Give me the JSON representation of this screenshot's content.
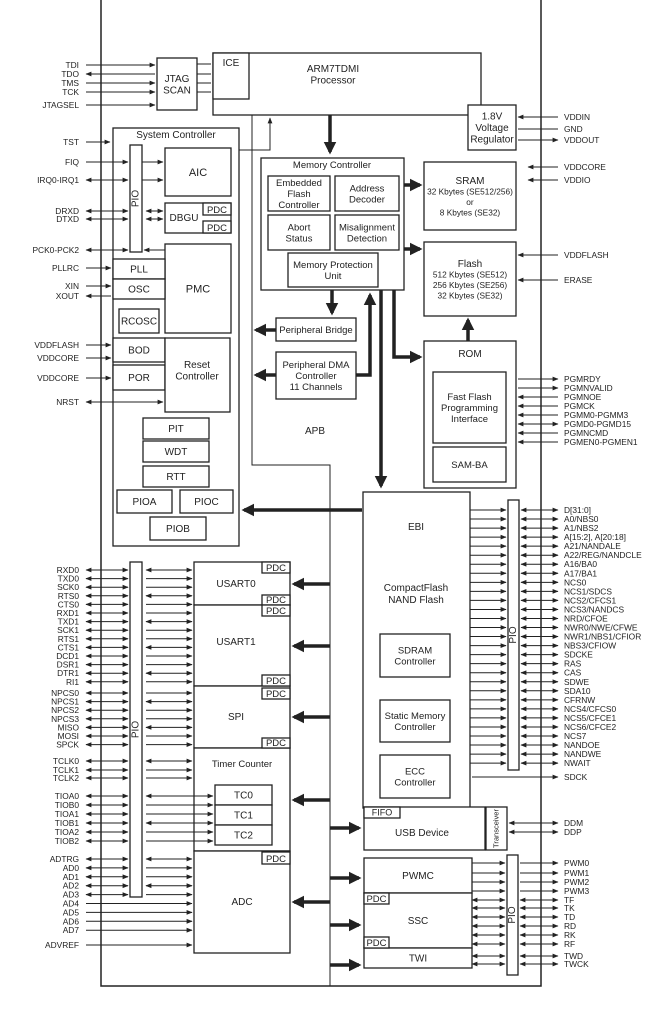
{
  "blocks": {
    "jtag": [
      "JTAG",
      "SCAN"
    ],
    "ice": [
      "ICE"
    ],
    "arm": [
      "ARM7TDMI",
      "Processor"
    ],
    "vreg": [
      "1.8V",
      "Voltage",
      "Regulator"
    ],
    "sysctrl": [
      "System Controller"
    ],
    "pio": "PIO",
    "pdc": "PDC",
    "aic": [
      "AIC"
    ],
    "dbgu": [
      "DBGU"
    ],
    "pmc": [
      "PMC"
    ],
    "pll": [
      "PLL"
    ],
    "osc": [
      "OSC"
    ],
    "rcosc": [
      "RCOSC"
    ],
    "bod": [
      "BOD"
    ],
    "por": [
      "POR"
    ],
    "reset": [
      "Reset",
      "Controller"
    ],
    "pit": [
      "PIT"
    ],
    "wdt": [
      "WDT"
    ],
    "rtt": [
      "RTT"
    ],
    "pioa": [
      "PIOA"
    ],
    "pioc": [
      "PIOC"
    ],
    "piob": [
      "PIOB"
    ],
    "memctrl": [
      "Memory Controller"
    ],
    "eflash": [
      "Embedded",
      "Flash",
      "Controller"
    ],
    "addrdec": [
      "Address",
      "Decoder"
    ],
    "abort": [
      "Abort",
      "Status"
    ],
    "misalign": [
      "Misalignment",
      "Detection"
    ],
    "mpu": [
      "Memory Protection",
      "Unit"
    ],
    "sram": [
      "SRAM",
      "32 Kbytes (SE512/256)",
      "or",
      "8 Kbytes  (SE32)"
    ],
    "flash": [
      "Flash",
      "512 Kbytes (SE512)",
      "256 Kbytes (SE256)",
      "32 Kbytes  (SE32)"
    ],
    "rom": [
      "ROM"
    ],
    "ffpi": [
      "Fast Flash",
      "Programming",
      "Interface"
    ],
    "samba": [
      "SAM-BA"
    ],
    "pbridge": [
      "Peripheral Bridge"
    ],
    "pdma": [
      "Peripheral DMA",
      "Controller",
      "11 Channels"
    ],
    "apb": "APB",
    "ebi": [
      "EBI"
    ],
    "cf": [
      "CompactFlash",
      "NAND Flash"
    ],
    "sdram": [
      "SDRAM",
      "Controller"
    ],
    "smc": [
      "Static Memory",
      "Controller"
    ],
    "ecc": [
      "ECC",
      "Controller"
    ],
    "usb": [
      "USB Device"
    ],
    "fifo": [
      "FIFO"
    ],
    "transceiver": "Transceiver",
    "pwmc": [
      "PWMC"
    ],
    "ssc": [
      "SSC"
    ],
    "twi": [
      "TWI"
    ],
    "usart0": [
      "USART0"
    ],
    "usart1": [
      "USART1"
    ],
    "spi": [
      "SPI"
    ],
    "tc": [
      "Timer Counter"
    ],
    "tc0": [
      "TC0"
    ],
    "tc1": [
      "TC1"
    ],
    "tc2": [
      "TC2"
    ],
    "adc": [
      "ADC"
    ]
  },
  "signals": {
    "left_jtag": [
      {
        "name": "TDI",
        "dir": "in"
      },
      {
        "name": "TDO",
        "dir": "out"
      },
      {
        "name": "TMS",
        "dir": "in"
      },
      {
        "name": "TCK",
        "dir": "in"
      },
      {
        "name": "JTAGSEL",
        "dir": "in"
      }
    ],
    "left_sys": [
      {
        "name": "TST",
        "dir": "in"
      },
      {
        "name": "FIQ",
        "dir": "in"
      },
      {
        "name": "IRQ0-IRQ1",
        "dir": "bi"
      },
      {
        "name": "DRXD",
        "dir": "bi"
      },
      {
        "name": "DTXD",
        "dir": "bi"
      },
      {
        "name": "PCK0-PCK2",
        "dir": "bi"
      },
      {
        "name": "PLLRC",
        "dir": "in"
      },
      {
        "name": "XIN",
        "dir": "in"
      },
      {
        "name": "XOUT",
        "dir": "out"
      },
      {
        "name": "VDDFLASH",
        "dir": "in"
      },
      {
        "name": "VDDCORE",
        "dir": "in"
      },
      {
        "name": "VDDCORE",
        "dir": "in"
      },
      {
        "name": "NRST",
        "dir": "bi"
      }
    ],
    "left_periph": [
      {
        "name": "RXD0",
        "dir": "bi"
      },
      {
        "name": "TXD0",
        "dir": "bi"
      },
      {
        "name": "SCK0",
        "dir": "bi"
      },
      {
        "name": "RTS0",
        "dir": "bi"
      },
      {
        "name": "CTS0",
        "dir": "bi"
      },
      {
        "name": "RXD1",
        "dir": "bi"
      },
      {
        "name": "TXD1",
        "dir": "bi"
      },
      {
        "name": "SCK1",
        "dir": "bi"
      },
      {
        "name": "RTS1",
        "dir": "bi"
      },
      {
        "name": "CTS1",
        "dir": "bi"
      },
      {
        "name": "DCD1",
        "dir": "bi"
      },
      {
        "name": "DSR1",
        "dir": "bi"
      },
      {
        "name": "DTR1",
        "dir": "bi"
      },
      {
        "name": "RI1",
        "dir": "bi"
      },
      {
        "name": "NPCS0",
        "dir": "bi"
      },
      {
        "name": "NPCS1",
        "dir": "bi"
      },
      {
        "name": "NPCS2",
        "dir": "bi"
      },
      {
        "name": "NPCS3",
        "dir": "bi"
      },
      {
        "name": "MISO",
        "dir": "bi"
      },
      {
        "name": "MOSI",
        "dir": "bi"
      },
      {
        "name": "SPCK",
        "dir": "bi"
      },
      {
        "name": "TCLK0",
        "dir": "bi"
      },
      {
        "name": "TCLK1",
        "dir": "bi"
      },
      {
        "name": "TCLK2",
        "dir": "bi"
      },
      {
        "name": "TIOA0",
        "dir": "bi"
      },
      {
        "name": "TIOB0",
        "dir": "bi"
      },
      {
        "name": "TIOA1",
        "dir": "bi"
      },
      {
        "name": "TIOB1",
        "dir": "bi"
      },
      {
        "name": "TIOA2",
        "dir": "bi"
      },
      {
        "name": "TIOB2",
        "dir": "bi"
      },
      {
        "name": "ADTRG",
        "dir": "bi"
      },
      {
        "name": "AD0",
        "dir": "bi"
      },
      {
        "name": "AD1",
        "dir": "bi"
      },
      {
        "name": "AD2",
        "dir": "bi"
      },
      {
        "name": "AD3",
        "dir": "bi"
      },
      {
        "name": "AD4",
        "dir": "in"
      },
      {
        "name": "AD5",
        "dir": "in"
      },
      {
        "name": "AD6",
        "dir": "in"
      },
      {
        "name": "AD7",
        "dir": "in"
      },
      {
        "name": "ADVREF",
        "dir": "in"
      }
    ],
    "right_power": [
      {
        "name": "VDDIN",
        "dir": "in"
      },
      {
        "name": "GND",
        "dir": "none"
      },
      {
        "name": "VDDOUT",
        "dir": "out"
      },
      {
        "name": "VDDCORE",
        "dir": "in"
      },
      {
        "name": "VDDIO",
        "dir": "in"
      },
      {
        "name": "VDDFLASH",
        "dir": "in"
      },
      {
        "name": "ERASE",
        "dir": "in"
      }
    ],
    "right_pgm": [
      {
        "name": "PGMRDY",
        "dir": "out"
      },
      {
        "name": "PGMNVALID",
        "dir": "out"
      },
      {
        "name": "PGMNOE",
        "dir": "in"
      },
      {
        "name": "PGMCK",
        "dir": "in"
      },
      {
        "name": "PGMM0-PGMM3",
        "dir": "in"
      },
      {
        "name": "PGMD0-PGMD15",
        "dir": "bi"
      },
      {
        "name": "PGMNCMD",
        "dir": "in"
      },
      {
        "name": "PGMEN0-PGMEN1",
        "dir": "in"
      }
    ],
    "right_ebi": [
      {
        "name": "D[31:0]",
        "dir": "bi"
      },
      {
        "name": "A0/NBS0",
        "dir": "bi"
      },
      {
        "name": "A1/NBS2",
        "dir": "bi"
      },
      {
        "name": "A[15:2], A[20:18]",
        "dir": "bi"
      },
      {
        "name": "A21/NANDALE",
        "dir": "bi"
      },
      {
        "name": "A22/REG/NANDCLE",
        "dir": "bi"
      },
      {
        "name": "A16/BA0",
        "dir": "bi"
      },
      {
        "name": "A17/BA1",
        "dir": "bi"
      },
      {
        "name": "NCS0",
        "dir": "bi"
      },
      {
        "name": "NCS1/SDCS",
        "dir": "bi"
      },
      {
        "name": "NCS2/CFCS1",
        "dir": "bi"
      },
      {
        "name": "NCS3/NANDCS",
        "dir": "bi"
      },
      {
        "name": "NRD/CFOE",
        "dir": "bi"
      },
      {
        "name": "NWR0/NWE/CFWE",
        "dir": "bi"
      },
      {
        "name": "NWR1/NBS1/CFIOR",
        "dir": "bi"
      },
      {
        "name": "NBS3/CFIOW",
        "dir": "bi"
      },
      {
        "name": "SDCKE",
        "dir": "bi"
      },
      {
        "name": "RAS",
        "dir": "bi"
      },
      {
        "name": "CAS",
        "dir": "bi"
      },
      {
        "name": "SDWE",
        "dir": "bi"
      },
      {
        "name": "SDA10",
        "dir": "bi"
      },
      {
        "name": "CFRNW",
        "dir": "bi"
      },
      {
        "name": "NCS4/CFCS0",
        "dir": "bi"
      },
      {
        "name": "NCS5/CFCE1",
        "dir": "bi"
      },
      {
        "name": "NCS6/CFCE2",
        "dir": "bi"
      },
      {
        "name": "NCS7",
        "dir": "bi"
      },
      {
        "name": "NANDOE",
        "dir": "bi"
      },
      {
        "name": "NANDWE",
        "dir": "bi"
      },
      {
        "name": "NWAIT",
        "dir": "bi"
      },
      {
        "name": "SDCK",
        "dir": "out"
      }
    ],
    "right_usb": [
      {
        "name": "DDM",
        "dir": "bi"
      },
      {
        "name": "DDP",
        "dir": "bi"
      }
    ],
    "right_pwm": [
      {
        "name": "PWM0",
        "dir": "out"
      },
      {
        "name": "PWM1",
        "dir": "out"
      },
      {
        "name": "PWM2",
        "dir": "out"
      },
      {
        "name": "PWM3",
        "dir": "out"
      },
      {
        "name": "TF",
        "dir": "bi"
      },
      {
        "name": "TK",
        "dir": "bi"
      },
      {
        "name": "TD",
        "dir": "bi"
      },
      {
        "name": "RD",
        "dir": "bi"
      },
      {
        "name": "RK",
        "dir": "bi"
      },
      {
        "name": "RF",
        "dir": "bi"
      },
      {
        "name": "TWD",
        "dir": "bi"
      },
      {
        "name": "TWCK",
        "dir": "bi"
      }
    ]
  },
  "colors": {
    "line": "#222222",
    "background": "#ffffff"
  }
}
